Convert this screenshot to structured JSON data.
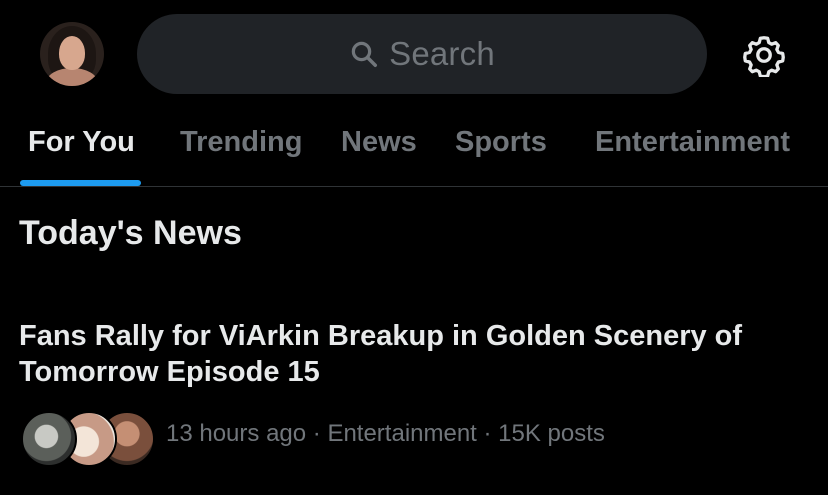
{
  "header": {
    "search_placeholder": "Search"
  },
  "tabs": [
    {
      "label": "For You",
      "active": true
    },
    {
      "label": "Trending",
      "active": false
    },
    {
      "label": "News",
      "active": false
    },
    {
      "label": "Sports",
      "active": false
    },
    {
      "label": "Entertainment",
      "active": false
    }
  ],
  "section": {
    "title": "Today's News"
  },
  "news": [
    {
      "headline": "Fans Rally for ViArkin Breakup in Golden Scenery of Tomorrow Episode 15",
      "meta": "13 hours ago · Entertainment · 15K posts"
    }
  ],
  "colors": {
    "background": "#000000",
    "accent": "#1d9bf0",
    "primary_text": "#e7e9ea",
    "secondary_text": "#71767b",
    "search_bg": "#202327"
  },
  "icons": {
    "search": "search-icon",
    "settings": "gear-icon"
  }
}
